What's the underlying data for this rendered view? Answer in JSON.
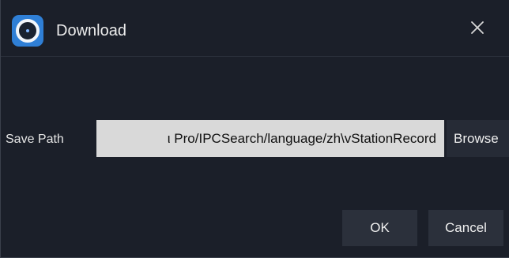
{
  "window": {
    "title": "Download",
    "app_icon": "camera-lens-icon",
    "close_icon": "close-icon"
  },
  "form": {
    "save_path_label": "Save Path",
    "save_path_value": "ι Pro/IPCSearch/language/zh\\vStationRecord",
    "browse_label": "Browse"
  },
  "actions": {
    "ok_label": "OK",
    "cancel_label": "Cancel"
  },
  "colors": {
    "background": "#1b1f29",
    "button": "#2b303b",
    "field": "#d9d9d9",
    "accent": "#2f7fd6"
  }
}
